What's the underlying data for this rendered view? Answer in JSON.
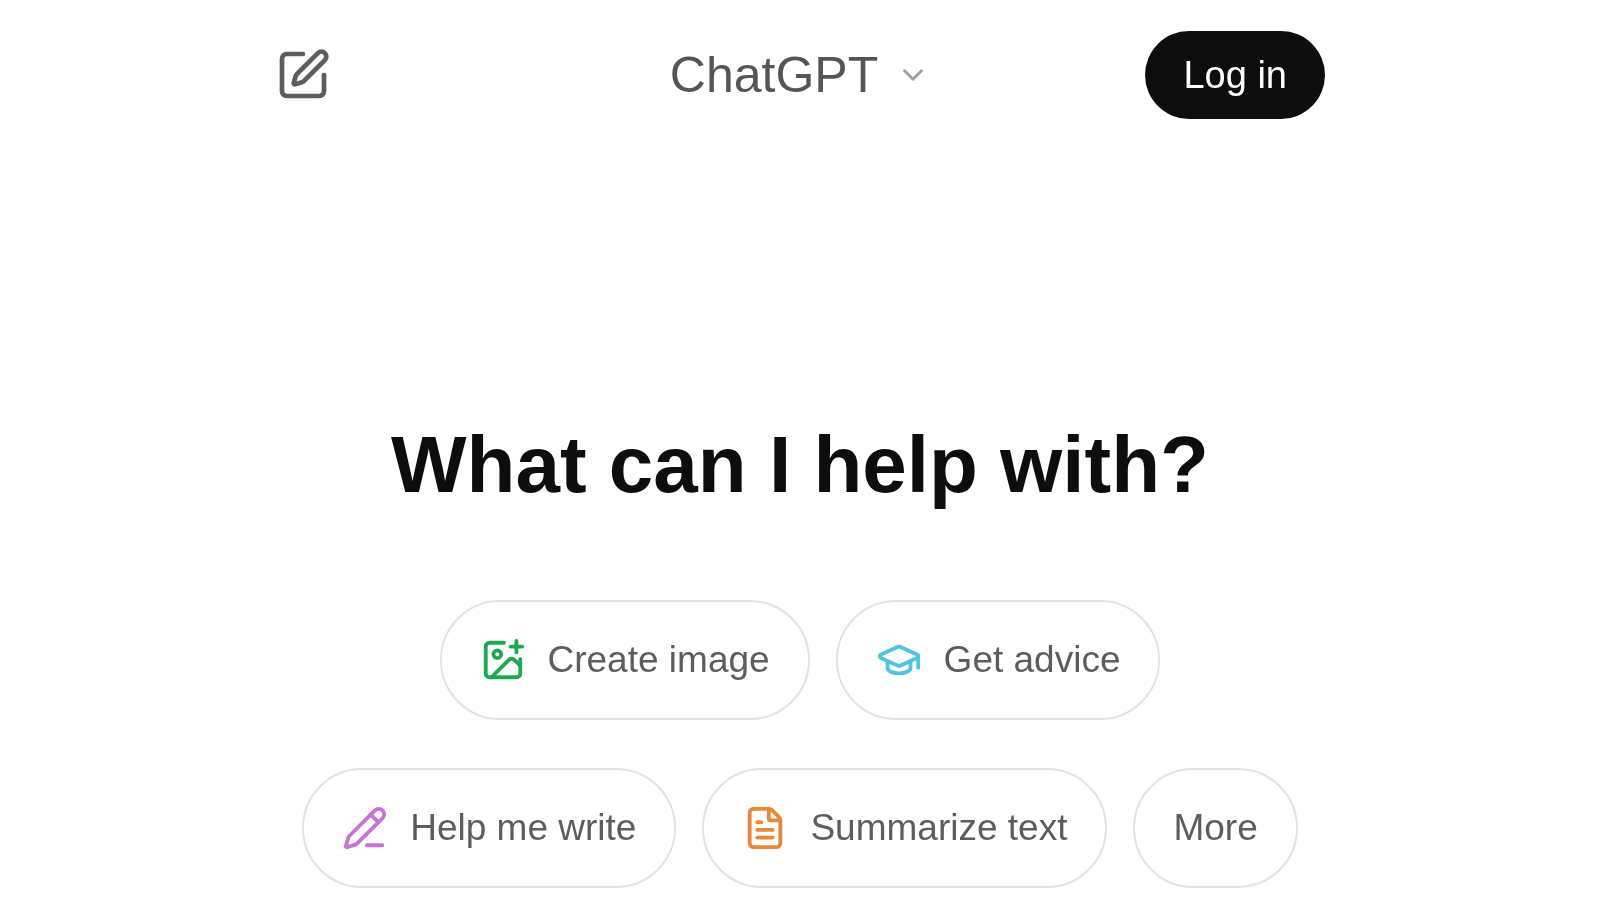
{
  "header": {
    "title": "ChatGPT",
    "login_button": "Log in"
  },
  "heading": "What can I help with?",
  "suggestion_rows": [
    [
      {
        "label": "Create image",
        "kind": "image",
        "color": "#1fa84f"
      },
      {
        "label": "Get advice",
        "kind": "advice",
        "color": "#4fc3e0"
      }
    ],
    [
      {
        "label": "Help me write",
        "kind": "write",
        "color": "#c774d6"
      },
      {
        "label": "Summarize text",
        "kind": "summarize",
        "color": "#e8883a"
      },
      {
        "label": "More",
        "kind": "more"
      }
    ]
  ]
}
